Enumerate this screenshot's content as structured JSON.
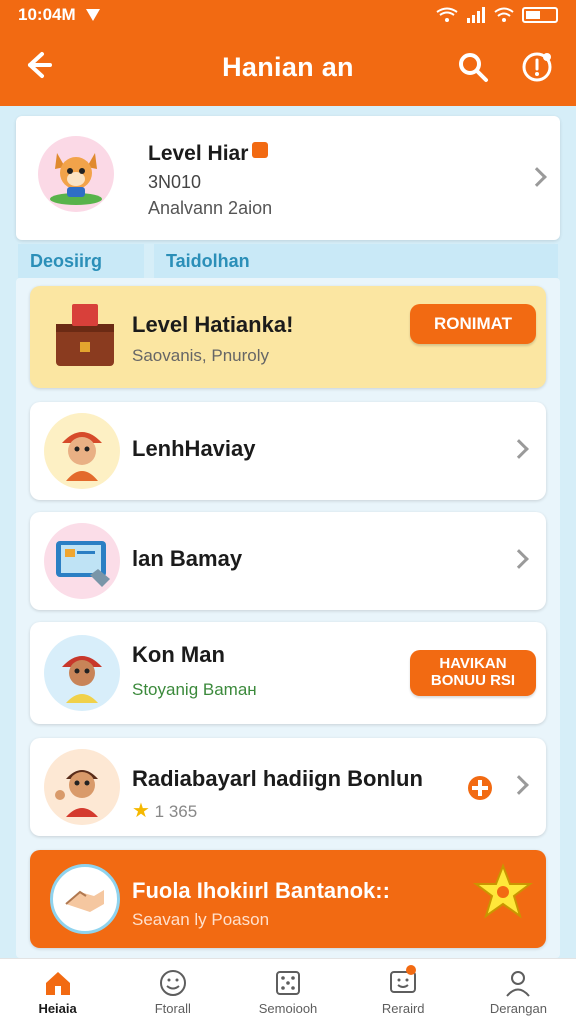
{
  "status_bar": {
    "time": "10:04M"
  },
  "app_bar": {
    "title": "Hanian an"
  },
  "profile": {
    "name": "Level Hiar",
    "id": "3N010",
    "subtitle": "Analvann 2aion"
  },
  "tabs": [
    {
      "label": "Deosiirg"
    },
    {
      "label": "Taidolhan"
    }
  ],
  "cards": [
    {
      "title": "Level Hatianka!",
      "subtitle": "Saovanis, Pnuroly",
      "button": "RONIMAT"
    },
    {
      "title": "LenhHaviay"
    },
    {
      "title": "lan Bamay"
    },
    {
      "title": "Kon Man",
      "subtitle": "Stoyanig Bamaн",
      "button": "HAVIKAN BONUU RSI"
    },
    {
      "title": "Radiabayarl hadiign Bonlun",
      "subtitle": "1 365"
    },
    {
      "title": "Fuola Ihokiırl Bantanok::",
      "subtitle": "Seavan ly Poason"
    }
  ],
  "bottom_nav": [
    {
      "label": "Heiaia"
    },
    {
      "label": "Ftorall"
    },
    {
      "label": "Semoiooh"
    },
    {
      "label": "Reraird"
    },
    {
      "label": "Derangan"
    }
  ],
  "colors": {
    "accent": "#f26a12",
    "featured_bg": "#fbe6a2",
    "panel_bg": "#d6eef8"
  }
}
